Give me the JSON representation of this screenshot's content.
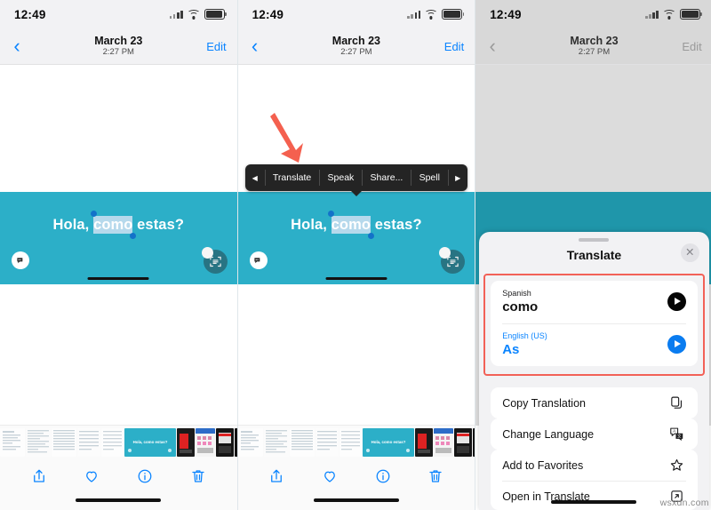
{
  "status_bar": {
    "time": "12:49",
    "icons": [
      "cellular-signal-icon",
      "wifi-icon",
      "battery-icon"
    ]
  },
  "nav": {
    "back_glyph": "‹",
    "title": "March 23",
    "subtitle": "2:27 PM",
    "edit_label": "Edit"
  },
  "photo": {
    "text_before": "Hola, ",
    "text_selected": "como",
    "text_after": " estas?",
    "background_color": "#2cafc8",
    "background_color_dimmed": "#1f96aa"
  },
  "context_menu": {
    "prev_glyph": "◀",
    "next_glyph": "▶",
    "items": [
      "Translate",
      "Speak",
      "Share...",
      "Spell"
    ]
  },
  "annotation": {
    "arrow_color": "#f4604f",
    "highlight_box_color": "#f26157"
  },
  "toolbar": {
    "items": [
      {
        "name": "share-button",
        "icon": "share-icon"
      },
      {
        "name": "favorite-button",
        "icon": "heart-icon"
      },
      {
        "name": "info-button",
        "icon": "info-icon"
      },
      {
        "name": "delete-button",
        "icon": "trash-icon"
      }
    ],
    "accent_color": "#0a84ff"
  },
  "filmstrip": {
    "selected_thumb_label": "Hola, como estas?"
  },
  "translate_sheet": {
    "title": "Translate",
    "close_glyph": "✕",
    "source": {
      "language": "Spanish",
      "text": "como",
      "play": "play-button"
    },
    "target": {
      "language": "English (US)",
      "text": "As",
      "play": "play-button"
    },
    "menu": [
      {
        "label": "Copy Translation",
        "icon": "copy-icon"
      },
      {
        "label": "Change Language",
        "icon": "change-language-icon"
      },
      {
        "label": "Add to Favorites",
        "icon": "star-icon"
      },
      {
        "label": "Open in Translate",
        "icon": "open-external-icon"
      }
    ]
  },
  "watermark": "wsxdn.com"
}
